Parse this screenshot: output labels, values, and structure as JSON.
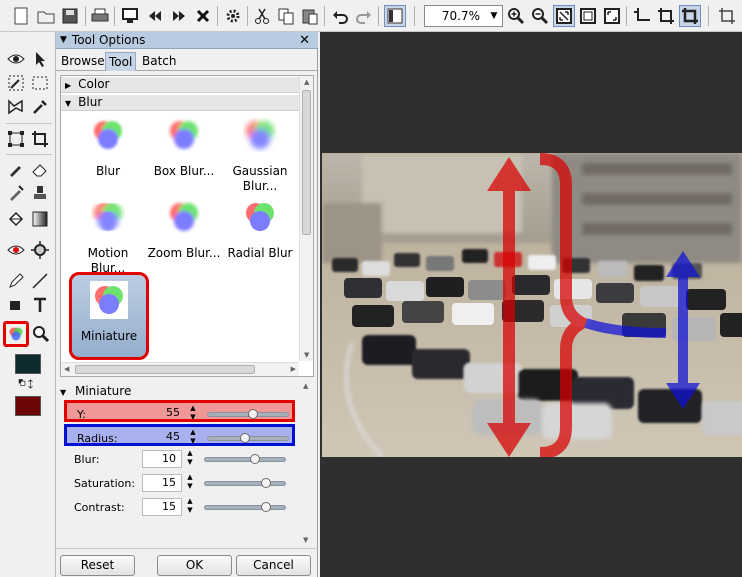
{
  "toolbar": {
    "zoom": "70.7%",
    "icons": [
      "new-icon",
      "open-icon",
      "save-icon",
      "print-icon",
      "screen-icon",
      "prev-icon",
      "next-icon",
      "close-icon",
      "settings-icon",
      "cut-icon",
      "copy-icon",
      "paste-icon",
      "undo-icon",
      "redo-icon",
      "panel-toggle-icon",
      "zoom-in-icon",
      "zoom-out-icon",
      "fit-icon",
      "actual-size-icon",
      "fullscreen-icon",
      "crop-corner-icon",
      "crop-icon",
      "crop-mode-icon"
    ]
  },
  "panel": {
    "title": "Tool Options",
    "tabs": [
      "Browse",
      "Tool",
      "Batch"
    ],
    "active_tab": "Tool",
    "categories": [
      "Color",
      "Blur"
    ],
    "effects": [
      {
        "line1": "Blur",
        "line2": ""
      },
      {
        "line1": "Box Blur...",
        "line2": ""
      },
      {
        "line1": "Gaussian",
        "line2": "Blur..."
      },
      {
        "line1": "Motion",
        "line2": "Blur..."
      },
      {
        "line1": "Zoom Blur...",
        "line2": ""
      },
      {
        "line1": "Radial Blur",
        "line2": ""
      },
      {
        "line1": "Miniature",
        "line2": ""
      }
    ],
    "selected_effect": "Miniature",
    "settings_title": "Miniature",
    "settings": [
      {
        "label": "Y:",
        "value": "55",
        "level": 0.55
      },
      {
        "label": "Radius:",
        "value": "45",
        "level": 0.45
      },
      {
        "label": "Blur:",
        "value": "10",
        "level": 0.63
      },
      {
        "label": "Saturation:",
        "value": "15",
        "level": 0.78
      },
      {
        "label": "Contrast:",
        "value": "15",
        "level": 0.78
      }
    ],
    "buttons": {
      "reset": "Reset",
      "ok": "OK",
      "cancel": "Cancel"
    }
  },
  "colors": {
    "accent": "#b9cbe0",
    "highlight_red": "#e00000",
    "highlight_blue": "#0010d0",
    "foreground_swatch": "#0e2a2e",
    "background_swatch": "#6e0606"
  }
}
